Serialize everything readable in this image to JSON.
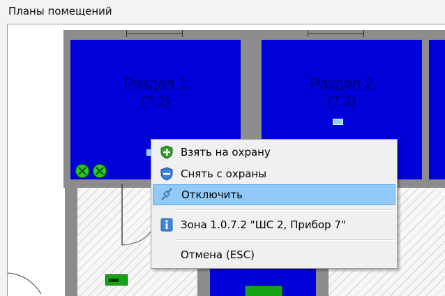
{
  "panel": {
    "title": "Планы помещений"
  },
  "rooms": [
    {
      "name": "Раздел 1",
      "number": "(7.2)"
    },
    {
      "name": "Раздел 2",
      "number": "(7.3)"
    }
  ],
  "context_menu": {
    "items": [
      {
        "label": "Взять на охрану",
        "icon": "shield-plus-icon",
        "highlighted": false
      },
      {
        "label": "Снять с охраны",
        "icon": "shield-minus-icon",
        "highlighted": false
      },
      {
        "label": "Отключить",
        "icon": "disconnect-plug-icon",
        "highlighted": true
      },
      {
        "label": "Зона 1.0.7.2 \"ШС 2, Прибор 7\"",
        "icon": "info-icon",
        "highlighted": false
      },
      {
        "label": "Отмена (ESC)",
        "icon": "",
        "highlighted": false
      }
    ]
  },
  "colors": {
    "room_fill": "#0000d9",
    "menu_highlight": "#91c9f7",
    "zone_green": "#22cc22",
    "wall": "#8c8c8c"
  }
}
